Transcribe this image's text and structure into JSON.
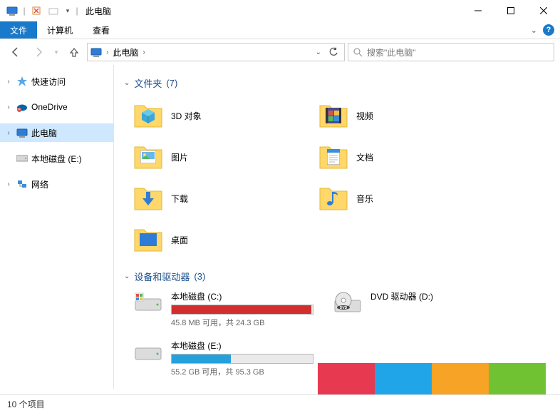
{
  "window": {
    "title": "此电脑"
  },
  "menubar": {
    "file": "文件",
    "computer": "计算机",
    "view": "查看"
  },
  "nav": {
    "breadcrumb": "此电脑",
    "search_placeholder": "搜索\"此电脑\""
  },
  "sidebar": {
    "quick_access": "快速访问",
    "onedrive": "OneDrive",
    "this_pc": "此电脑",
    "local_disk_e": "本地磁盘 (E:)",
    "network": "网络"
  },
  "groups": {
    "folders": {
      "label": "文件夹",
      "count": "(7)"
    },
    "devices": {
      "label": "设备和驱动器",
      "count": "(3)"
    }
  },
  "folders": {
    "objects3d": "3D 对象",
    "videos": "视频",
    "pictures": "图片",
    "documents": "文档",
    "downloads": "下载",
    "music": "音乐",
    "desktop": "桌面"
  },
  "drives": {
    "c": {
      "name": "本地磁盘 (C:)",
      "stats": "45.8 MB 可用，共 24.3 GB",
      "fill_pct": 99,
      "fill_color": "#d22e2e"
    },
    "e": {
      "name": "本地磁盘 (E:)",
      "stats": "55.2 GB 可用，共 95.3 GB",
      "fill_pct": 42,
      "fill_color": "#26a0da"
    },
    "dvd": {
      "name": "DVD 驱动器 (D:)"
    }
  },
  "status": {
    "items": "10 个项目"
  },
  "strip_colors": [
    "#e7394f",
    "#20a6e8",
    "#f7a325",
    "#71c232"
  ]
}
